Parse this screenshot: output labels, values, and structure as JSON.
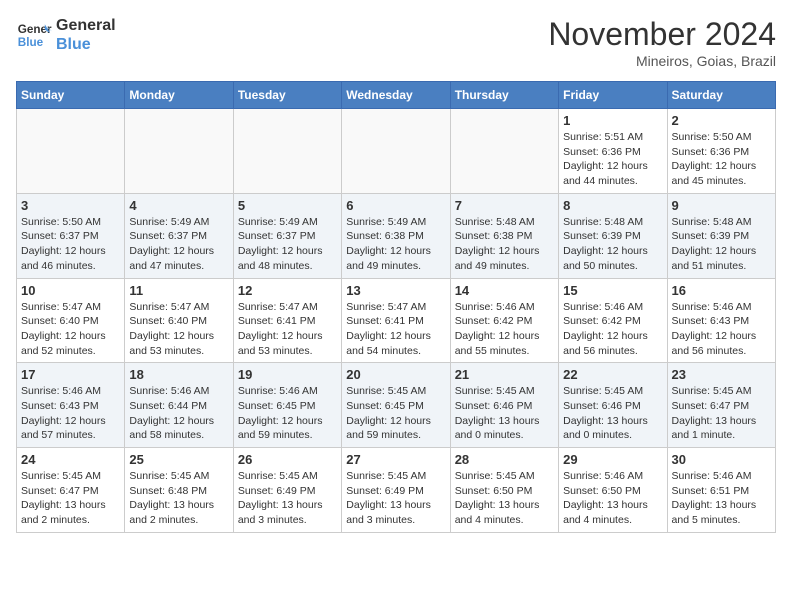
{
  "header": {
    "logo_line1": "General",
    "logo_line2": "Blue",
    "month": "November 2024",
    "location": "Mineiros, Goias, Brazil"
  },
  "days_of_week": [
    "Sunday",
    "Monday",
    "Tuesday",
    "Wednesday",
    "Thursday",
    "Friday",
    "Saturday"
  ],
  "weeks": [
    [
      {
        "day": "",
        "info": ""
      },
      {
        "day": "",
        "info": ""
      },
      {
        "day": "",
        "info": ""
      },
      {
        "day": "",
        "info": ""
      },
      {
        "day": "",
        "info": ""
      },
      {
        "day": "1",
        "info": "Sunrise: 5:51 AM\nSunset: 6:36 PM\nDaylight: 12 hours and 44 minutes."
      },
      {
        "day": "2",
        "info": "Sunrise: 5:50 AM\nSunset: 6:36 PM\nDaylight: 12 hours and 45 minutes."
      }
    ],
    [
      {
        "day": "3",
        "info": "Sunrise: 5:50 AM\nSunset: 6:37 PM\nDaylight: 12 hours and 46 minutes."
      },
      {
        "day": "4",
        "info": "Sunrise: 5:49 AM\nSunset: 6:37 PM\nDaylight: 12 hours and 47 minutes."
      },
      {
        "day": "5",
        "info": "Sunrise: 5:49 AM\nSunset: 6:37 PM\nDaylight: 12 hours and 48 minutes."
      },
      {
        "day": "6",
        "info": "Sunrise: 5:49 AM\nSunset: 6:38 PM\nDaylight: 12 hours and 49 minutes."
      },
      {
        "day": "7",
        "info": "Sunrise: 5:48 AM\nSunset: 6:38 PM\nDaylight: 12 hours and 49 minutes."
      },
      {
        "day": "8",
        "info": "Sunrise: 5:48 AM\nSunset: 6:39 PM\nDaylight: 12 hours and 50 minutes."
      },
      {
        "day": "9",
        "info": "Sunrise: 5:48 AM\nSunset: 6:39 PM\nDaylight: 12 hours and 51 minutes."
      }
    ],
    [
      {
        "day": "10",
        "info": "Sunrise: 5:47 AM\nSunset: 6:40 PM\nDaylight: 12 hours and 52 minutes."
      },
      {
        "day": "11",
        "info": "Sunrise: 5:47 AM\nSunset: 6:40 PM\nDaylight: 12 hours and 53 minutes."
      },
      {
        "day": "12",
        "info": "Sunrise: 5:47 AM\nSunset: 6:41 PM\nDaylight: 12 hours and 53 minutes."
      },
      {
        "day": "13",
        "info": "Sunrise: 5:47 AM\nSunset: 6:41 PM\nDaylight: 12 hours and 54 minutes."
      },
      {
        "day": "14",
        "info": "Sunrise: 5:46 AM\nSunset: 6:42 PM\nDaylight: 12 hours and 55 minutes."
      },
      {
        "day": "15",
        "info": "Sunrise: 5:46 AM\nSunset: 6:42 PM\nDaylight: 12 hours and 56 minutes."
      },
      {
        "day": "16",
        "info": "Sunrise: 5:46 AM\nSunset: 6:43 PM\nDaylight: 12 hours and 56 minutes."
      }
    ],
    [
      {
        "day": "17",
        "info": "Sunrise: 5:46 AM\nSunset: 6:43 PM\nDaylight: 12 hours and 57 minutes."
      },
      {
        "day": "18",
        "info": "Sunrise: 5:46 AM\nSunset: 6:44 PM\nDaylight: 12 hours and 58 minutes."
      },
      {
        "day": "19",
        "info": "Sunrise: 5:46 AM\nSunset: 6:45 PM\nDaylight: 12 hours and 59 minutes."
      },
      {
        "day": "20",
        "info": "Sunrise: 5:45 AM\nSunset: 6:45 PM\nDaylight: 12 hours and 59 minutes."
      },
      {
        "day": "21",
        "info": "Sunrise: 5:45 AM\nSunset: 6:46 PM\nDaylight: 13 hours and 0 minutes."
      },
      {
        "day": "22",
        "info": "Sunrise: 5:45 AM\nSunset: 6:46 PM\nDaylight: 13 hours and 0 minutes."
      },
      {
        "day": "23",
        "info": "Sunrise: 5:45 AM\nSunset: 6:47 PM\nDaylight: 13 hours and 1 minute."
      }
    ],
    [
      {
        "day": "24",
        "info": "Sunrise: 5:45 AM\nSunset: 6:47 PM\nDaylight: 13 hours and 2 minutes."
      },
      {
        "day": "25",
        "info": "Sunrise: 5:45 AM\nSunset: 6:48 PM\nDaylight: 13 hours and 2 minutes."
      },
      {
        "day": "26",
        "info": "Sunrise: 5:45 AM\nSunset: 6:49 PM\nDaylight: 13 hours and 3 minutes."
      },
      {
        "day": "27",
        "info": "Sunrise: 5:45 AM\nSunset: 6:49 PM\nDaylight: 13 hours and 3 minutes."
      },
      {
        "day": "28",
        "info": "Sunrise: 5:45 AM\nSunset: 6:50 PM\nDaylight: 13 hours and 4 minutes."
      },
      {
        "day": "29",
        "info": "Sunrise: 5:46 AM\nSunset: 6:50 PM\nDaylight: 13 hours and 4 minutes."
      },
      {
        "day": "30",
        "info": "Sunrise: 5:46 AM\nSunset: 6:51 PM\nDaylight: 13 hours and 5 minutes."
      }
    ]
  ]
}
